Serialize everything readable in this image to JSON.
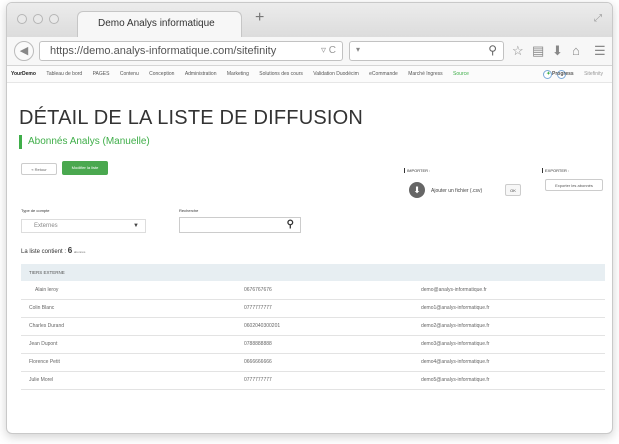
{
  "browser": {
    "tab_title": "Demo Analys informatique",
    "new_tab": "+",
    "url": "https://demo.analys-informatique.com/sitefinity",
    "url_icons": "▿ C",
    "search_dropdown": "▾",
    "toolbar_icons": [
      "☆",
      "▤",
      "⬇",
      "⌂",
      "☰"
    ],
    "colors": {
      "titlebar": "#dcdcdc",
      "tab_bg": "#f7f7f7"
    }
  },
  "appbar": {
    "brand": "YourDemo",
    "items": [
      "Tableau de bord",
      "PAGES",
      "Contenu",
      "Conception",
      "Administration",
      "Marketing",
      "Solutions des cours",
      "Validation Duodécim",
      "eCommande",
      "Marché Ingress"
    ],
    "sub_label": "Source",
    "progress_label": "Progress",
    "progress_suffix": "Sitefinity"
  },
  "page": {
    "title": "DÉTAIL DE LA LISTE DE DIFFUSION",
    "subtitle": "Abonnés Analys (Manuelle)",
    "retour_label": "« Retour",
    "modifier_label": "Modifier la liste",
    "import_label": "IMPORTER :",
    "add_file_label": "Ajouter un fichier (.csv)",
    "ok_label": "OK",
    "export_label": "EXPORTER :",
    "export_button": "Exporter les abonnés",
    "type_label": "Type de compte",
    "type_value": "Externes",
    "search_label": "Recherche",
    "count_prefix": "La liste contient :",
    "count_value": "6",
    "count_suffix": "abonnés",
    "accent_color": "#3fae49"
  },
  "table": {
    "header": "TIERS EXTERNE",
    "rows": [
      {
        "name": "Alain leroy",
        "phone": "0676767676",
        "email": "demo@analys-informatique.fr"
      },
      {
        "name": "Colin Blanc",
        "phone": "0777777777",
        "email": "demo1@analys-informatique.fr"
      },
      {
        "name": "Charles Durand",
        "phone": "0602040300201",
        "email": "demo2@analys-informatique.fr"
      },
      {
        "name": "Jean Dupont",
        "phone": "0788888888",
        "email": "demo3@analys-informatique.fr"
      },
      {
        "name": "Florence Petit",
        "phone": "0666666666",
        "email": "demo4@analys-informatique.fr"
      },
      {
        "name": "Julie Morel",
        "phone": "0777777777",
        "email": "demo5@analys-informatique.fr"
      }
    ]
  }
}
